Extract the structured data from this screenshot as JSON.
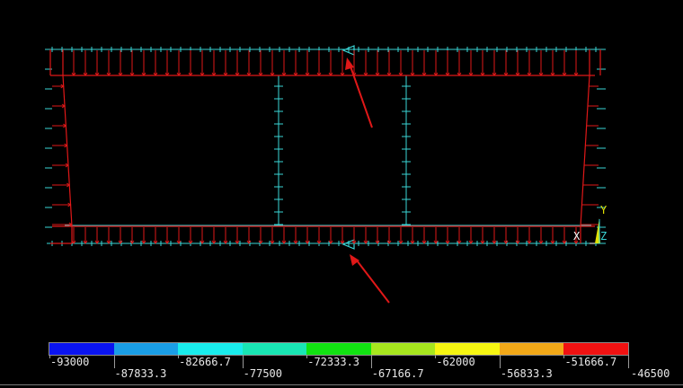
{
  "viewport": {
    "background": "#000000",
    "mesh_color": "#3ad6d6",
    "pressure_color": "#e01818",
    "annotation_arrow_color": "#e01818"
  },
  "triad": {
    "x_label": "X",
    "y_label": "Y",
    "z_label": "Z",
    "x_color": "#ffffff",
    "y_color": "#e0e000",
    "z_color": "#3ad6d6"
  },
  "colorbar": {
    "colors": [
      "#0a14f0",
      "#1a9ee6",
      "#19ecec",
      "#19e6b4",
      "#12e212",
      "#a6e61e",
      "#f6f612",
      "#f2a818",
      "#f01212"
    ],
    "labels": [
      "-93000",
      "-87833.3",
      "-82666.7",
      "-77500",
      "-72333.3",
      "-67166.7",
      "-62000",
      "-56833.3",
      "-51666.7",
      "-46500"
    ]
  }
}
